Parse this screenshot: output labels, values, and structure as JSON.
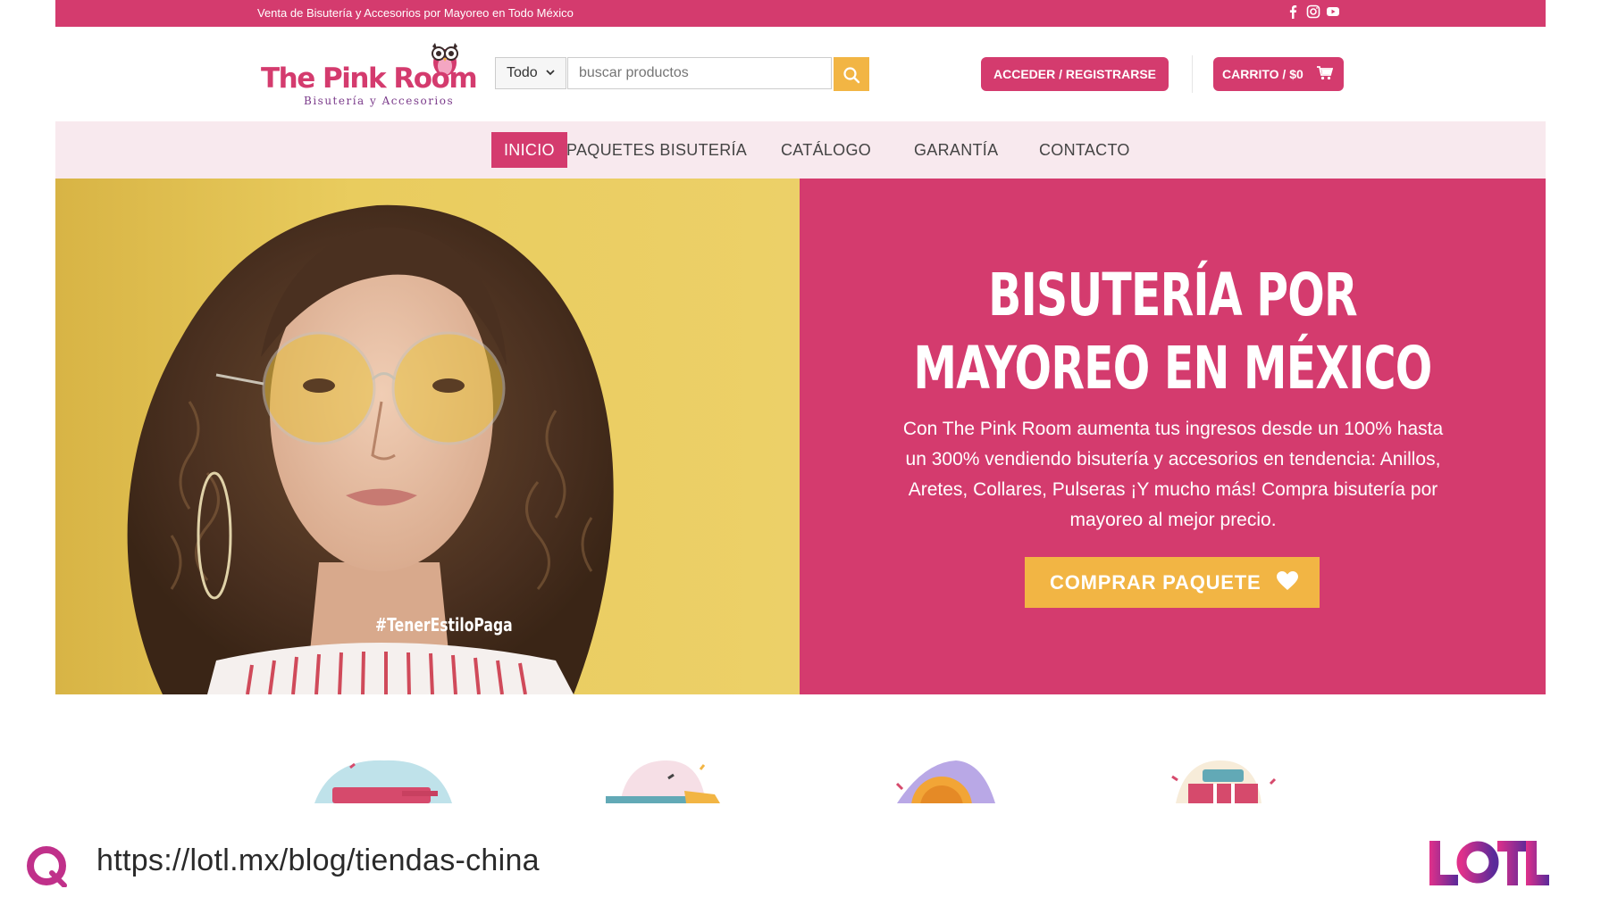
{
  "topbar": {
    "text": "Venta de Bisutería y Accesorios por Mayoreo en Todo México",
    "social_icons": [
      "facebook-icon",
      "instagram-icon",
      "youtube-icon"
    ]
  },
  "header": {
    "logo_title": "The Pink Room",
    "logo_subtitle": "Bisutería y Accesorios",
    "search": {
      "category": "Todo",
      "placeholder": "buscar productos"
    },
    "login_label": "ACCEDER / REGISTRARSE",
    "cart_label": "CARRITO / $0"
  },
  "nav": {
    "items": [
      {
        "label": "INICIO",
        "active": true
      },
      {
        "label": "PAQUETES BISUTERÍA",
        "active": false
      },
      {
        "label": "CATÁLOGO",
        "active": false
      },
      {
        "label": "GARANTÍA",
        "active": false
      },
      {
        "label": "CONTACTO",
        "active": false
      }
    ]
  },
  "hero": {
    "title_line1": "BISUTERÍA POR",
    "title_line2": "MAYOREO EN MÉXICO",
    "text": "Con The Pink Room aumenta tus ingresos desde un 100% hasta un 300% vendiendo bisutería y accesorios en tendencia: Anillos, Aretes, Collares, Pulseras ¡Y mucho más! Compra bisutería por mayoreo al mejor precio.",
    "cta_label": "COMPRAR PAQUETE",
    "image_hashtag": "#TenerEstiloPaga"
  },
  "footer_overlay": {
    "url": "https://lotl.mx/blog/tiendas-china",
    "brand": "LOTL"
  },
  "colors": {
    "brand_pink": "#d43b6e",
    "accent_yellow": "#f2b544",
    "nav_bg": "#f8e9ee"
  }
}
